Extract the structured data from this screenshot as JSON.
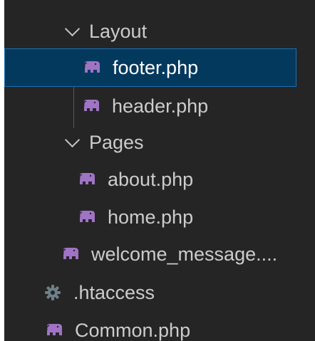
{
  "explorer": {
    "folders": {
      "layout": {
        "label": "Layout",
        "expanded": true
      },
      "pages": {
        "label": "Pages",
        "expanded": true
      }
    },
    "files": {
      "footer": {
        "label": "footer.php",
        "icon": "php-elephant-icon",
        "selected": true
      },
      "header": {
        "label": "header.php",
        "icon": "php-elephant-icon"
      },
      "about": {
        "label": "about.php",
        "icon": "php-elephant-icon"
      },
      "home": {
        "label": "home.php",
        "icon": "php-elephant-icon"
      },
      "welcome": {
        "label": "welcome_message....",
        "icon": "php-elephant-icon"
      },
      "htaccess": {
        "label": ".htaccess",
        "icon": "gear-icon"
      },
      "common": {
        "label": "Common.php",
        "icon": "php-elephant-icon"
      }
    }
  },
  "colors": {
    "background": "#252526",
    "selection": "#04395e",
    "selection_border": "#1a6fb2",
    "php_icon": "#a074c4",
    "gear_icon": "#6d8086",
    "text": "#cccccc"
  }
}
